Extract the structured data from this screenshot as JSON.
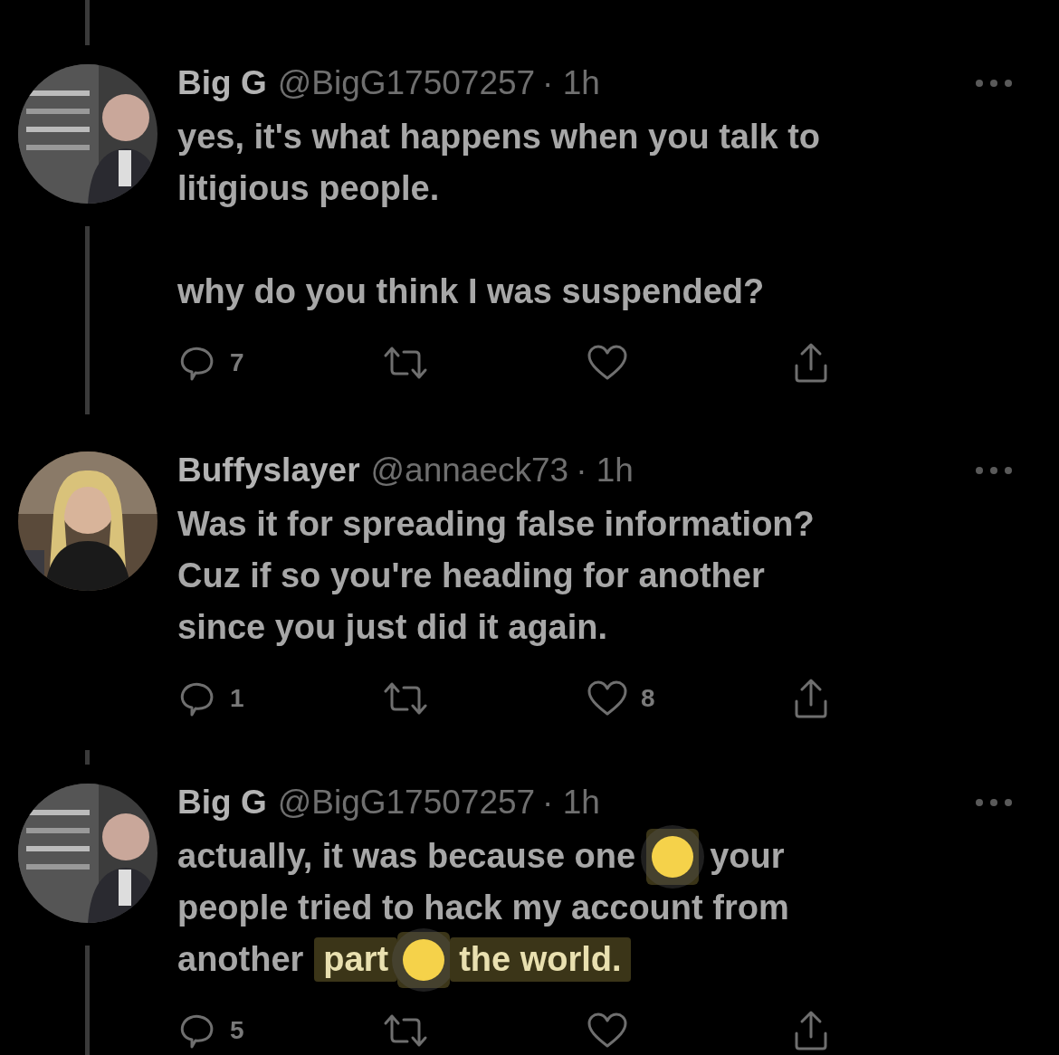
{
  "tweets": [
    {
      "name": "Big G",
      "handle": "@BigG17507257",
      "time": "· 1h",
      "thread_line_above": true,
      "thread_line_below": true,
      "paragraphs": [
        [
          [
            {
              "kind": "text",
              "text": "yes, it's what happens when you talk to",
              "selected": false
            }
          ],
          [
            {
              "kind": "text",
              "text": "litigious people.",
              "selected": false
            }
          ]
        ],
        [
          [
            {
              "kind": "text",
              "text": "why do you think I was suspended?",
              "selected": false
            }
          ]
        ]
      ],
      "replies": "7"
    },
    {
      "name": "Buffyslayer",
      "handle": "@annaeck73",
      "time": "· 1h",
      "thread_line_above": false,
      "thread_line_below": false,
      "paragraphs": [
        [
          [
            {
              "kind": "text",
              "text": "Was it for spreading false information?",
              "selected": false
            }
          ],
          [
            {
              "kind": "text",
              "text": "Cuz if so you're heading for another",
              "selected": false
            }
          ],
          [
            {
              "kind": "text",
              "text": "since you just did it again.",
              "selected": false
            }
          ]
        ]
      ],
      "replies": "1",
      "likes": "8"
    },
    {
      "name": "Big G",
      "handle": "@BigG17507257",
      "time": "· 1h",
      "thread_line_above": true,
      "thread_line_below": true,
      "paragraphs": [
        [
          [
            {
              "kind": "text",
              "text": "actually, it was because one",
              "selected": false
            },
            {
              "kind": "handle",
              "selected": true
            },
            {
              "kind": "text",
              "text": "your",
              "selected": false
            }
          ],
          [
            {
              "kind": "text",
              "text": "people tried to hack my account from",
              "selected": false
            }
          ],
          [
            {
              "kind": "text",
              "text": "another",
              "selected": false
            },
            {
              "kind": "text",
              "text": "part",
              "selected": true
            },
            {
              "kind": "handle",
              "selected": true
            },
            {
              "kind": "text",
              "text": "the world.",
              "selected": true
            }
          ]
        ]
      ],
      "replies": "5"
    }
  ]
}
